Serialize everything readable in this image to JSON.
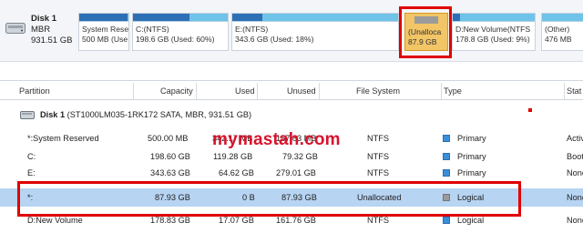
{
  "disk_map": {
    "disk": {
      "name": "Disk 1",
      "style": "MBR",
      "size": "931.51 GB"
    },
    "blocks": [
      {
        "label": "System Rese",
        "detail": "500 MB (Use",
        "used_fraction": 0.98,
        "selected": false
      },
      {
        "label": "C:(NTFS)",
        "detail": "198.6 GB (Used: 60%)",
        "used_fraction": 0.6,
        "selected": false
      },
      {
        "label": "E:(NTFS)",
        "detail": "343.6 GB (Used: 18%)",
        "used_fraction": 0.18,
        "selected": false
      },
      {
        "label": "(Unalloca",
        "detail": "87.9 GB",
        "used_fraction": 0,
        "selected": true
      },
      {
        "label": "D:New Volume(NTFS",
        "detail": "178.8 GB (Used: 9%)",
        "used_fraction": 0.09,
        "selected": false
      },
      {
        "label": "(Other)",
        "detail": "476 MB",
        "used_fraction": 0,
        "selected": false
      }
    ]
  },
  "columns": [
    "Partition",
    "Capacity",
    "Used",
    "Unused",
    "File System",
    "Type",
    "Stat"
  ],
  "group": {
    "name": "Disk 1",
    "detail": "(ST1000LM035-1RK172 SATA, MBR, 931.51 GB)"
  },
  "rows": [
    {
      "partition": "*:System Reserved",
      "capacity": "500.00 MB",
      "used": "342.17 MB",
      "unused": "157.83 MB",
      "fs": "NTFS",
      "type": "Primary",
      "status": "Activ",
      "selected": false
    },
    {
      "partition": "C:",
      "capacity": "198.60 GB",
      "used": "119.28 GB",
      "unused": "79.32 GB",
      "fs": "NTFS",
      "type": "Primary",
      "status": "Boot",
      "selected": false
    },
    {
      "partition": "E:",
      "capacity": "343.63 GB",
      "used": "64.62 GB",
      "unused": "279.01 GB",
      "fs": "NTFS",
      "type": "Primary",
      "status": "None",
      "selected": false
    },
    {
      "partition": "*:",
      "capacity": "87.93 GB",
      "used": "0 B",
      "unused": "87.93 GB",
      "fs": "Unallocated",
      "type": "Logical",
      "status": "None",
      "selected": true
    },
    {
      "partition": "D:New Volume",
      "capacity": "178.83 GB",
      "used": "17.07 GB",
      "unused": "161.76 GB",
      "fs": "NTFS",
      "type": "Logical",
      "status": "None",
      "selected": false
    }
  ],
  "watermark": "mymastah.com",
  "colors": {
    "accent": "#2d6fb5",
    "free": "#6fc3e8",
    "unallocated": "#f2c566",
    "selection": "#b7d4f2",
    "highlight": "#e00000"
  }
}
